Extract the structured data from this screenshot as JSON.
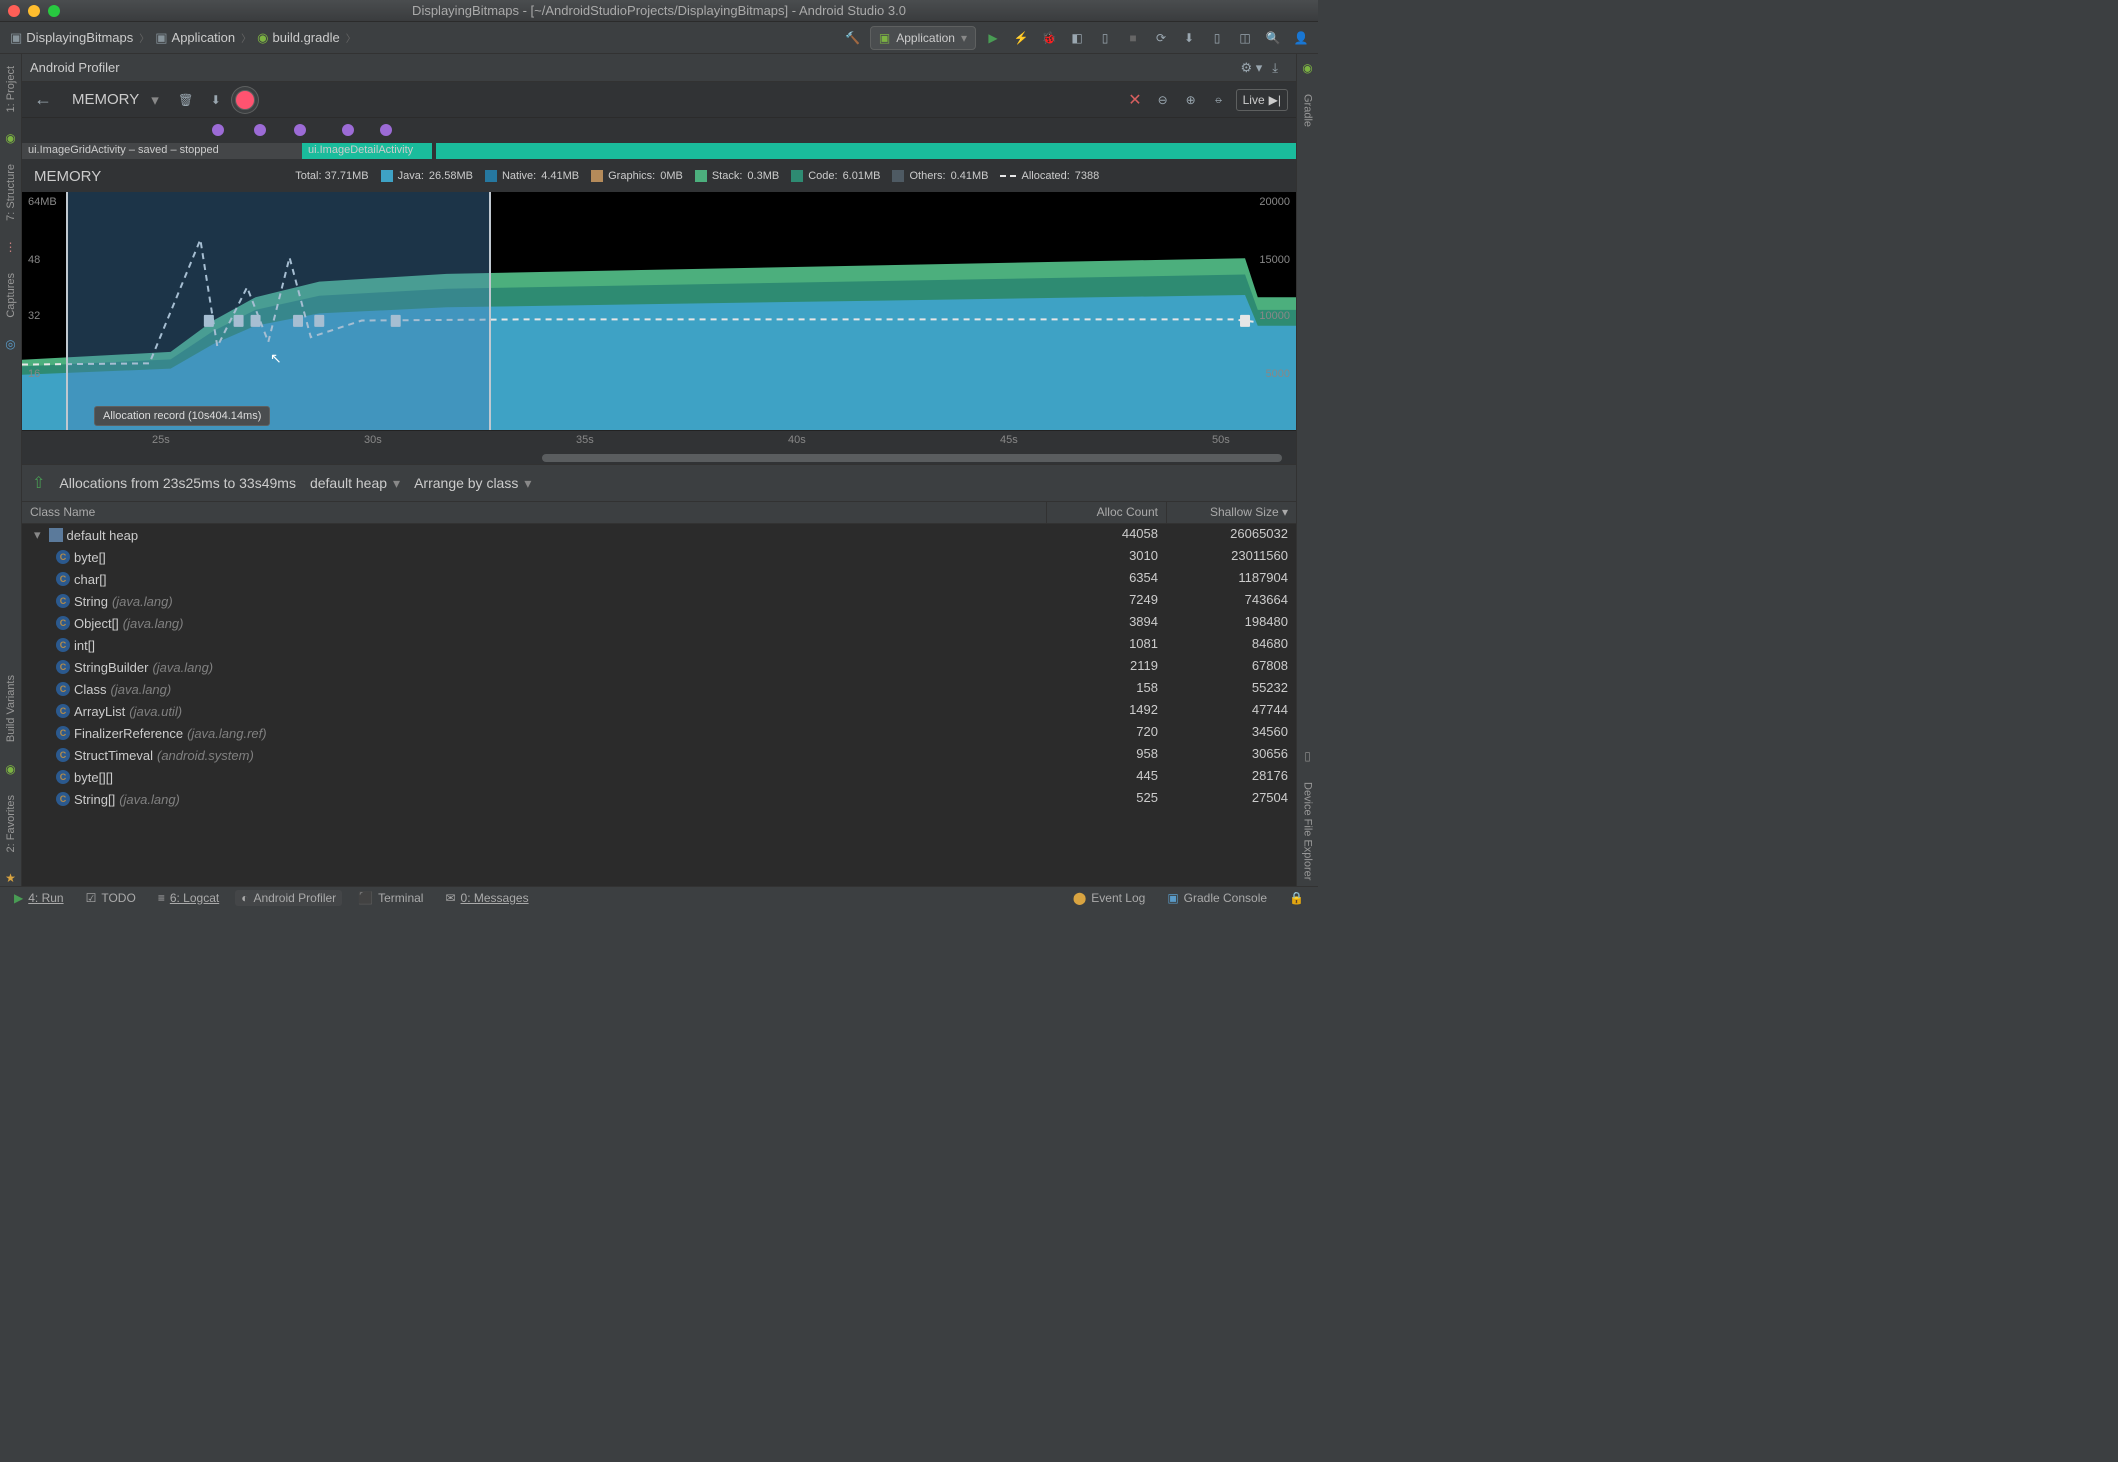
{
  "window": {
    "title": "DisplayingBitmaps - [~/AndroidStudioProjects/DisplayingBitmaps] - Android Studio 3.0"
  },
  "breadcrumbs": [
    "DisplayingBitmaps",
    "Application",
    "build.gradle"
  ],
  "run_config": "Application",
  "left_stripe": [
    {
      "label": "1: Project",
      "short": "1: Project"
    },
    {
      "label": "7: Structure",
      "short": "7: Structure"
    },
    {
      "label": "Captures",
      "short": "Captures"
    },
    {
      "label": "Build Variants",
      "short": "Build Variants"
    },
    {
      "label": "2: Favorites",
      "short": "2: Favorites"
    }
  ],
  "right_stripe": [
    {
      "label": "Gradle",
      "short": "Gradle"
    },
    {
      "label": "Device File Explorer",
      "short": "Device File Explorer"
    }
  ],
  "profiler": {
    "title": "Android Profiler",
    "section": "MEMORY",
    "live": "Live"
  },
  "activities": {
    "left": "ui.ImageGridActivity – saved – stopped",
    "right": "ui.ImageDetailActivity"
  },
  "memory_legend": {
    "title": "MEMORY",
    "total_label": "Total:",
    "total": "37.71MB",
    "java_label": "Java:",
    "java": "26.58MB",
    "native_label": "Native:",
    "native": "4.41MB",
    "graphics_label": "Graphics:",
    "graphics": "0MB",
    "stack_label": "Stack:",
    "stack": "0.3MB",
    "code_label": "Code:",
    "code": "6.01MB",
    "others_label": "Others:",
    "others": "0.41MB",
    "allocated_label": "Allocated:",
    "allocated": "7388"
  },
  "colors": {
    "java": "#3ea2c5",
    "native": "#2678a0",
    "graphics": "#b58b5a",
    "stack": "#4caf7d",
    "code": "#2e8b72",
    "others": "#4e5a63",
    "allocated_line": "#e6e6e6",
    "selection": "rgba(70,130,180,0.4)"
  },
  "chart_data": {
    "type": "area",
    "x_unit": "s",
    "x_ticks": [
      25,
      30,
      35,
      40,
      45,
      50
    ],
    "x_range": [
      22,
      52
    ],
    "y_left_label": "MB",
    "y_left_ticks": [
      16,
      32,
      48,
      64
    ],
    "y_left_range": [
      0,
      64
    ],
    "y_right_label": "Allocated",
    "y_right_ticks": [
      5000,
      10000,
      15000,
      20000
    ],
    "y_right_range": [
      0,
      20000
    ],
    "stack_series": [
      {
        "name": "Others",
        "color": "#4e5a63",
        "approx_value_mb": 0.41
      },
      {
        "name": "Code",
        "color": "#2e8b72",
        "approx_value_mb": 6.01
      },
      {
        "name": "Stack",
        "color": "#4caf7d",
        "approx_value_mb": 0.3
      },
      {
        "name": "Graphics",
        "color": "#b58b5a",
        "approx_value_mb": 0.0
      },
      {
        "name": "Native",
        "color": "#2678a0",
        "approx_value_mb": 4.41
      },
      {
        "name": "Java",
        "color": "#3ea2c5",
        "approx_value_mb": 26.58
      }
    ],
    "allocated_line": {
      "name": "Allocated",
      "color": "#e6e6e6",
      "samples": [
        {
          "t": 22,
          "v": 5500
        },
        {
          "t": 25,
          "v": 5600
        },
        {
          "t": 26.2,
          "v": 16000
        },
        {
          "t": 26.6,
          "v": 7000
        },
        {
          "t": 27.3,
          "v": 12000
        },
        {
          "t": 27.8,
          "v": 7400
        },
        {
          "t": 28.3,
          "v": 14500
        },
        {
          "t": 28.8,
          "v": 7800
        },
        {
          "t": 30,
          "v": 9200
        },
        {
          "t": 34,
          "v": 9300
        },
        {
          "t": 50.5,
          "v": 9300
        },
        {
          "t": 51,
          "v": 9100
        }
      ]
    },
    "selection": {
      "t_start": 23.025,
      "t_end": 33.049
    },
    "gc_markers_t": [
      26.4,
      27.1,
      27.5,
      28.5,
      29.0,
      30.8,
      50.8
    ],
    "tooltip": "Allocation record (10s404.14ms)"
  },
  "allocations": {
    "title": "Allocations from 23s25ms to 33s49ms",
    "heap_filter": "default heap",
    "arrange": "Arrange by class",
    "columns": [
      "Class Name",
      "Alloc Count",
      "Shallow Size"
    ],
    "rows": [
      {
        "indent": 0,
        "icon": "heap",
        "name": "default heap",
        "pkg": "",
        "count": 44058,
        "size": 26065032
      },
      {
        "indent": 1,
        "icon": "class",
        "name": "byte[]",
        "pkg": "",
        "count": 3010,
        "size": 23011560
      },
      {
        "indent": 1,
        "icon": "class",
        "name": "char[]",
        "pkg": "",
        "count": 6354,
        "size": 1187904
      },
      {
        "indent": 1,
        "icon": "class",
        "name": "String",
        "pkg": "(java.lang)",
        "count": 7249,
        "size": 743664
      },
      {
        "indent": 1,
        "icon": "class",
        "name": "Object[]",
        "pkg": "(java.lang)",
        "count": 3894,
        "size": 198480
      },
      {
        "indent": 1,
        "icon": "class",
        "name": "int[]",
        "pkg": "",
        "count": 1081,
        "size": 84680
      },
      {
        "indent": 1,
        "icon": "class",
        "name": "StringBuilder",
        "pkg": "(java.lang)",
        "count": 2119,
        "size": 67808
      },
      {
        "indent": 1,
        "icon": "class",
        "name": "Class",
        "pkg": "(java.lang)",
        "count": 158,
        "size": 55232
      },
      {
        "indent": 1,
        "icon": "class",
        "name": "ArrayList",
        "pkg": "(java.util)",
        "count": 1492,
        "size": 47744
      },
      {
        "indent": 1,
        "icon": "class",
        "name": "FinalizerReference",
        "pkg": "(java.lang.ref)",
        "count": 720,
        "size": 34560
      },
      {
        "indent": 1,
        "icon": "class",
        "name": "StructTimeval",
        "pkg": "(android.system)",
        "count": 958,
        "size": 30656
      },
      {
        "indent": 1,
        "icon": "class",
        "name": "byte[][]",
        "pkg": "",
        "count": 445,
        "size": 28176
      },
      {
        "indent": 1,
        "icon": "class",
        "name": "String[]",
        "pkg": "(java.lang)",
        "count": 525,
        "size": 27504
      }
    ]
  },
  "status_bar": {
    "items": [
      {
        "label": "4: Run",
        "icon": "play",
        "color": "#499c54"
      },
      {
        "label": "TODO",
        "icon": "todo"
      },
      {
        "label": "6: Logcat",
        "icon": "logcat"
      },
      {
        "label": "Android Profiler",
        "icon": "profiler",
        "active": true
      },
      {
        "label": "Terminal",
        "icon": "terminal"
      },
      {
        "label": "0: Messages",
        "icon": "messages"
      }
    ],
    "right": [
      {
        "label": "Event Log",
        "icon": "eventlog"
      },
      {
        "label": "Gradle Console",
        "icon": "gradle"
      }
    ]
  }
}
